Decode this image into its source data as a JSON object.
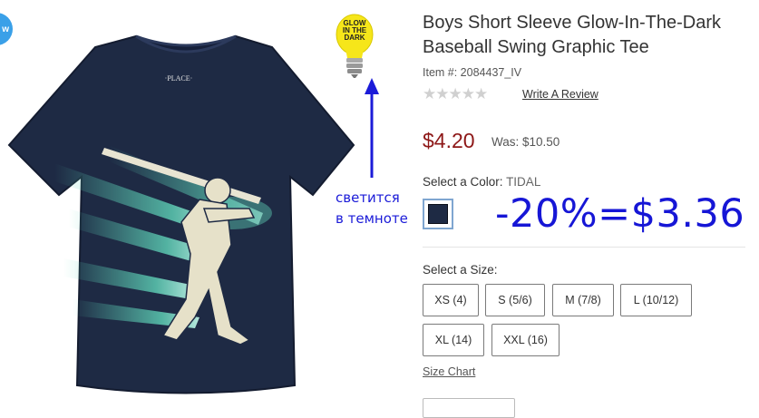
{
  "badge": {
    "text": "w"
  },
  "product": {
    "title": "Boys Short Sleeve Glow-In-The-Dark Baseball Swing Graphic Tee",
    "item_number": "Item #: 2084437_IV",
    "rating_stars": "★★★★★",
    "write_review": "Write A Review",
    "price": "$4.20",
    "was_price": "Was: $10.50",
    "color_label": "Select a Color:",
    "color_value": "TIDAL",
    "size_label": "Select a Size:",
    "sizes": [
      "XS (4)",
      "S (5/6)",
      "M (7/8)",
      "L (10/12)",
      "XL (14)",
      "XXL (16)"
    ],
    "size_chart": "Size Chart",
    "shirt_brand": "·PLACE·"
  },
  "glow_badge": {
    "line1": "GLOW",
    "line2": "IN THE",
    "line3": "DARK"
  },
  "annotation": {
    "line1": "светится",
    "line2": "в темноте",
    "discount": "-20%=$3.36"
  },
  "colors": {
    "price": "#8d1717",
    "annotation": "#1616d6",
    "shirt": "#1e2a44",
    "glow": "#5fd3b8",
    "bulb": "#f6e61a"
  }
}
